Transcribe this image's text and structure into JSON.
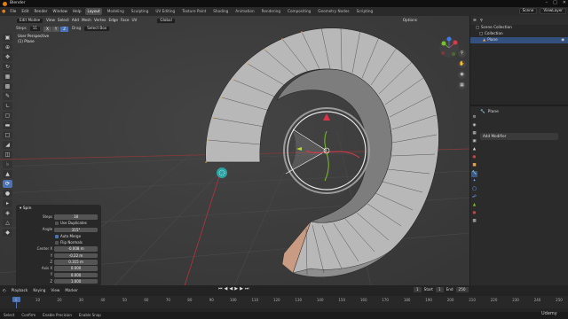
{
  "app": {
    "title": "Blender"
  },
  "menu": [
    "File",
    "Edit",
    "Render",
    "Window",
    "Help"
  ],
  "workspaces": [
    "Layout",
    "Modeling",
    "Sculpting",
    "UV Editing",
    "Texture Paint",
    "Shading",
    "Animation",
    "Rendering",
    "Compositing",
    "Geometry Nodes",
    "Scripting"
  ],
  "topright": {
    "scene": "Scene",
    "viewlayer": "ViewLayer"
  },
  "viewport_header": {
    "mode": "Edit Mode",
    "items": [
      "View",
      "Select",
      "Add",
      "Mesh",
      "Vertex",
      "Edge",
      "Face",
      "UV"
    ],
    "orientation": "Global",
    "options": "Options"
  },
  "tool_options": {
    "steps_label": "Steps",
    "steps_value": "11",
    "axes": [
      "X",
      "Y",
      "Z"
    ],
    "drag_label": "Drag",
    "drag_value": "Select Box"
  },
  "view_info": {
    "line1": "User Perspective",
    "line2": "(1) Plane"
  },
  "operator_panel": {
    "title": "Spin",
    "rows": [
      {
        "label": "Steps",
        "value": "18"
      },
      {
        "label": "",
        "check": "Use Duplicates",
        "on": false
      },
      {
        "label": "Angle",
        "value": "315°"
      },
      {
        "label": "",
        "check": "Auto Merge",
        "on": true
      },
      {
        "label": "",
        "check": "Flip Normals",
        "on": false
      },
      {
        "label": "Center X",
        "value": "-0.008 m"
      },
      {
        "label": "Y",
        "value": "-0.22 m"
      },
      {
        "label": "Z",
        "value": "0.315 m"
      },
      {
        "label": "Axis X",
        "value": "0.000"
      },
      {
        "label": "Y",
        "value": "0.000"
      },
      {
        "label": "Z",
        "value": "1.000"
      }
    ]
  },
  "outliner": {
    "title": "Scene Collection",
    "items": [
      {
        "label": "Scene Collection",
        "selected": false
      },
      {
        "label": "Collection",
        "selected": false
      },
      {
        "label": "Plane",
        "selected": true
      }
    ]
  },
  "properties": {
    "object_name": "Plane",
    "add_modifier": "Add Modifier"
  },
  "timeline": {
    "items": [
      "Playback",
      "Keying",
      "View",
      "Marker"
    ],
    "current": "1",
    "start_label": "Start",
    "start": "1",
    "end_label": "End",
    "end": "250",
    "ticks": [
      "0",
      "10",
      "20",
      "30",
      "40",
      "50",
      "60",
      "70",
      "80",
      "90",
      "100",
      "110",
      "120",
      "130",
      "140",
      "150",
      "160",
      "170",
      "180",
      "190",
      "200",
      "210",
      "220",
      "230",
      "240",
      "250"
    ]
  },
  "status": [
    "Select",
    "Confirm",
    "Enable Precision",
    "Enable Snap"
  ],
  "watermark": "Udemy",
  "colors": {
    "accent": "#4b73b5",
    "selected": "#33507e",
    "axis_x": "#e0304a",
    "axis_y": "#7ebd2a",
    "axis_z": "#3e7ce8"
  }
}
